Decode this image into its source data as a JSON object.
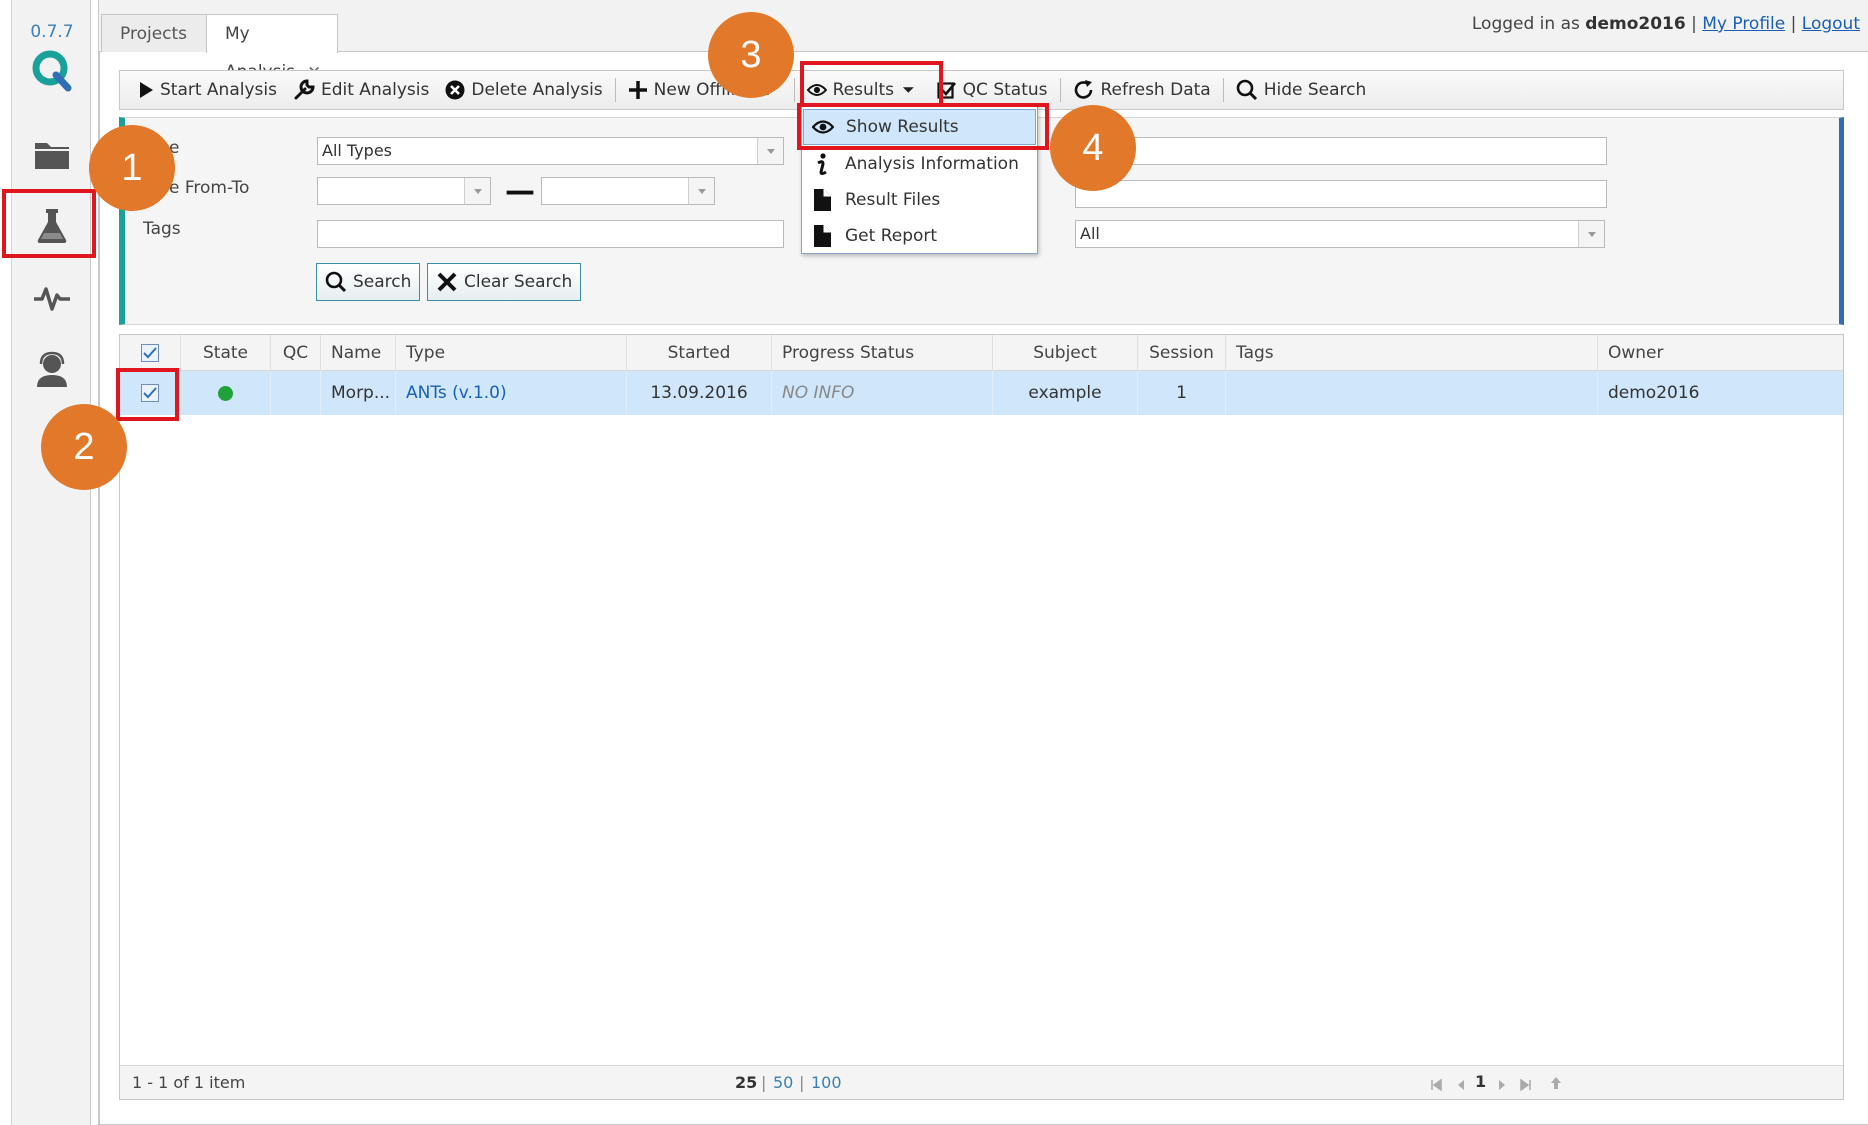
{
  "app": {
    "version": "0.7.7"
  },
  "rail": {
    "icons": [
      "logo-q-icon",
      "folder-icon",
      "flask-icon",
      "pulse-icon",
      "user-support-icon"
    ]
  },
  "tabs": [
    {
      "label": "Projects"
    },
    {
      "label": "My Analysis",
      "close": "×"
    }
  ],
  "user": {
    "logged_in_prefix": "Logged in as",
    "username": "demo2016",
    "sep1": "|",
    "profile_link": "My Profile",
    "sep2": "|",
    "logout_link": "Logout"
  },
  "toolbar": {
    "start_analysis": "Start Analysis",
    "edit_analysis": "Edit Analysis",
    "delete_analysis": "Delete Analysis",
    "new_offline": "New Offline A",
    "results": "Results",
    "qc_status": "QC Status",
    "refresh_data": "Refresh Data",
    "hide_search": "Hide Search"
  },
  "search": {
    "type_label": "e",
    "type_value": "All Types",
    "date_label": "e From-To",
    "date_dash": "—",
    "tags_label": "Tags",
    "right_select_value": "All",
    "search_button": "Search",
    "clear_button": "Clear Search"
  },
  "results_menu": {
    "items": [
      {
        "label": "Show Results",
        "icon": "eye-icon"
      },
      {
        "label": "Analysis Information",
        "icon": "info-icon"
      },
      {
        "label": "Result Files",
        "icon": "file-icon"
      },
      {
        "label": "Get Report",
        "icon": "file-icon"
      }
    ]
  },
  "grid": {
    "columns": [
      "State",
      "QC",
      "Name",
      "Type",
      "Started",
      "Progress Status",
      "Subject",
      "Session",
      "Tags",
      "Owner"
    ],
    "rows": [
      {
        "state_color": "#22a03a",
        "qc": "",
        "name": "Morp...",
        "type": "ANTs (v.1.0)",
        "started": "13.09.2016",
        "progress": "NO INFO",
        "subject": "example",
        "session": "1",
        "tags": "",
        "owner": "demo2016"
      }
    ],
    "footer": {
      "count": "1 - 1 of 1 item",
      "page_size_25": "25",
      "sep1": "|",
      "page_size_50": "50",
      "sep2": "|",
      "page_size_100": "100",
      "current_page": "1"
    }
  },
  "callouts": [
    "1",
    "2",
    "3",
    "4"
  ],
  "colors": {
    "accent_teal": "#1aa199",
    "accent_blue": "#2f6fb5",
    "callout_orange": "#e2782a",
    "highlight_red": "#e0161e",
    "row_selected": "#cfe6fb"
  }
}
